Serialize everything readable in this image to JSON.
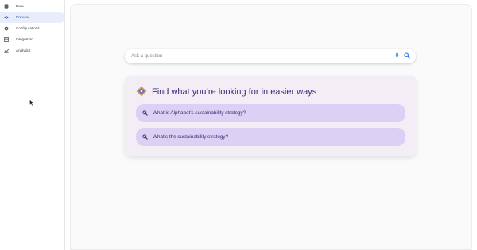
{
  "sidebar": {
    "items": [
      {
        "label": "Data",
        "icon": "database-icon",
        "active": false
      },
      {
        "label": "Preview",
        "icon": "eye-icon",
        "active": true
      },
      {
        "label": "Configurations",
        "icon": "gear-icon",
        "active": false
      },
      {
        "label": "Integration",
        "icon": "integration-icon",
        "active": false
      },
      {
        "label": "Analytics",
        "icon": "analytics-icon",
        "active": false
      }
    ]
  },
  "search": {
    "placeholder": "Ask a question"
  },
  "card": {
    "title": "Find what you’re looking for in easier ways",
    "suggestions": [
      {
        "text": "What is Alphabet’s sustainability strategy?"
      },
      {
        "text": "What’s the sustainability strategy?"
      }
    ]
  },
  "colors": {
    "accent": "#1a73e8",
    "active_nav_bg": "#e8ecfb",
    "card_bg": "#f3eef6",
    "suggestion_bg": "#ddd0f5",
    "title_text": "#3f2a7a"
  }
}
